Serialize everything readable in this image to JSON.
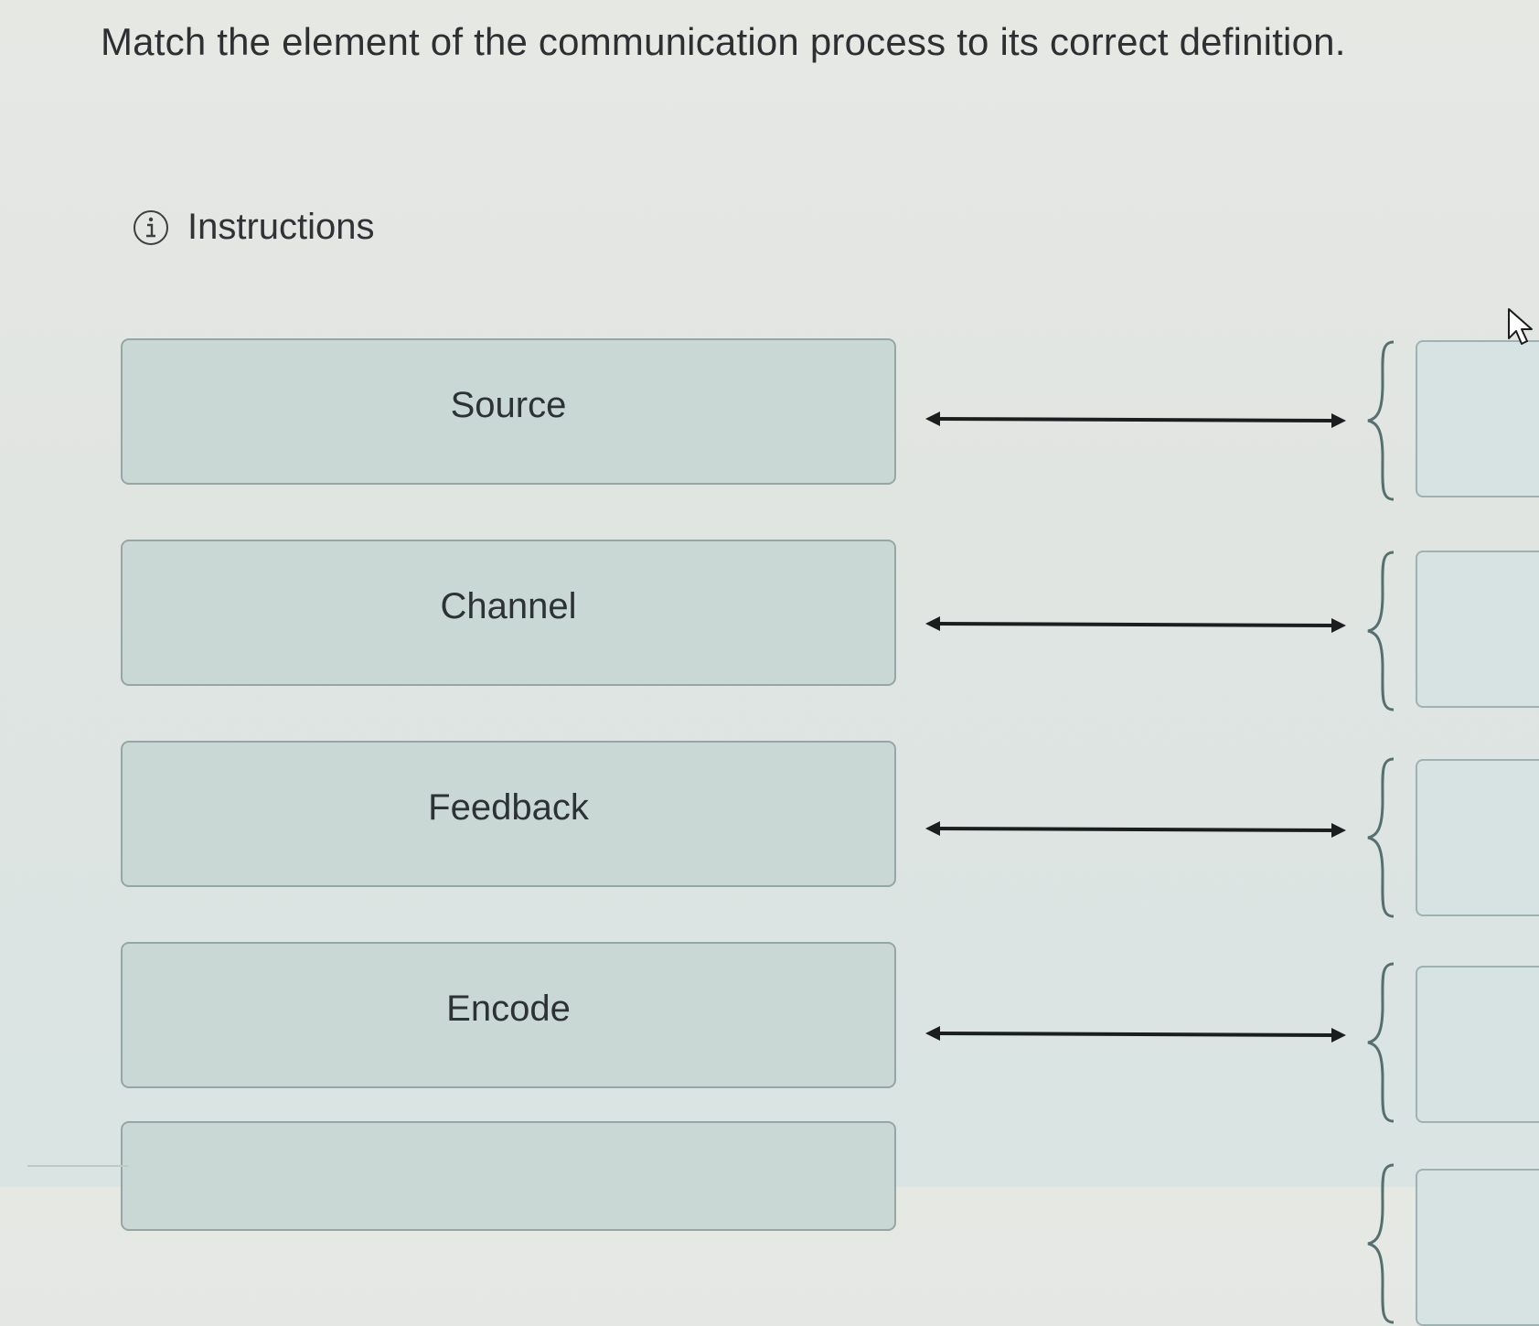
{
  "question": {
    "title": "Match the element of the communication process to its correct definition."
  },
  "instructions": {
    "icon": "info-icon",
    "label": "Instructions"
  },
  "prompts": [
    {
      "label": "Source"
    },
    {
      "label": "Channel"
    },
    {
      "label": "Feedback"
    },
    {
      "label": "Encode"
    },
    {
      "label": ""
    }
  ],
  "colors": {
    "card_background": "#c9d7d5",
    "card_border": "#96a6a5",
    "arrow": "#1b1d1f",
    "bracket": "#56706f",
    "page_background": "#e2e6e3"
  }
}
